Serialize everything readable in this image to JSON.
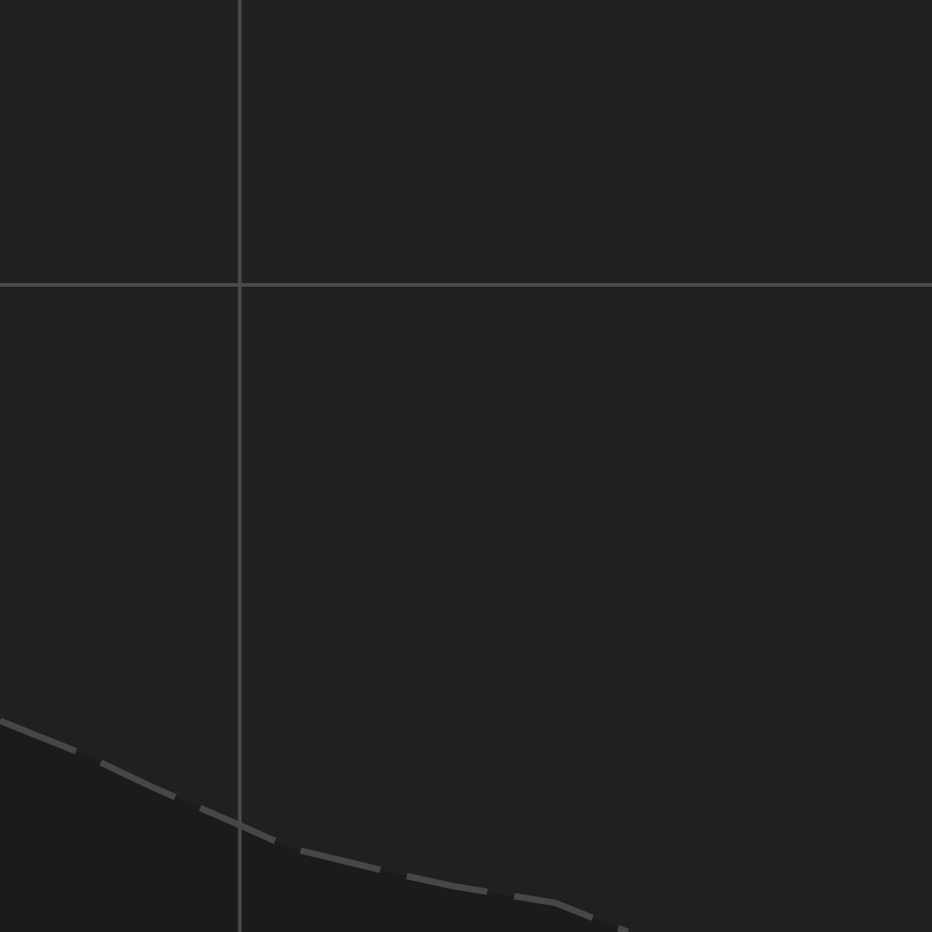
{
  "canvas": {
    "background_color": "#202020",
    "shaded_region_color": "#1b1b1b",
    "grid_line_color": "#4a4a4a",
    "dashed_curve_color": "#474747",
    "dashed_curve_style": "dashed"
  }
}
